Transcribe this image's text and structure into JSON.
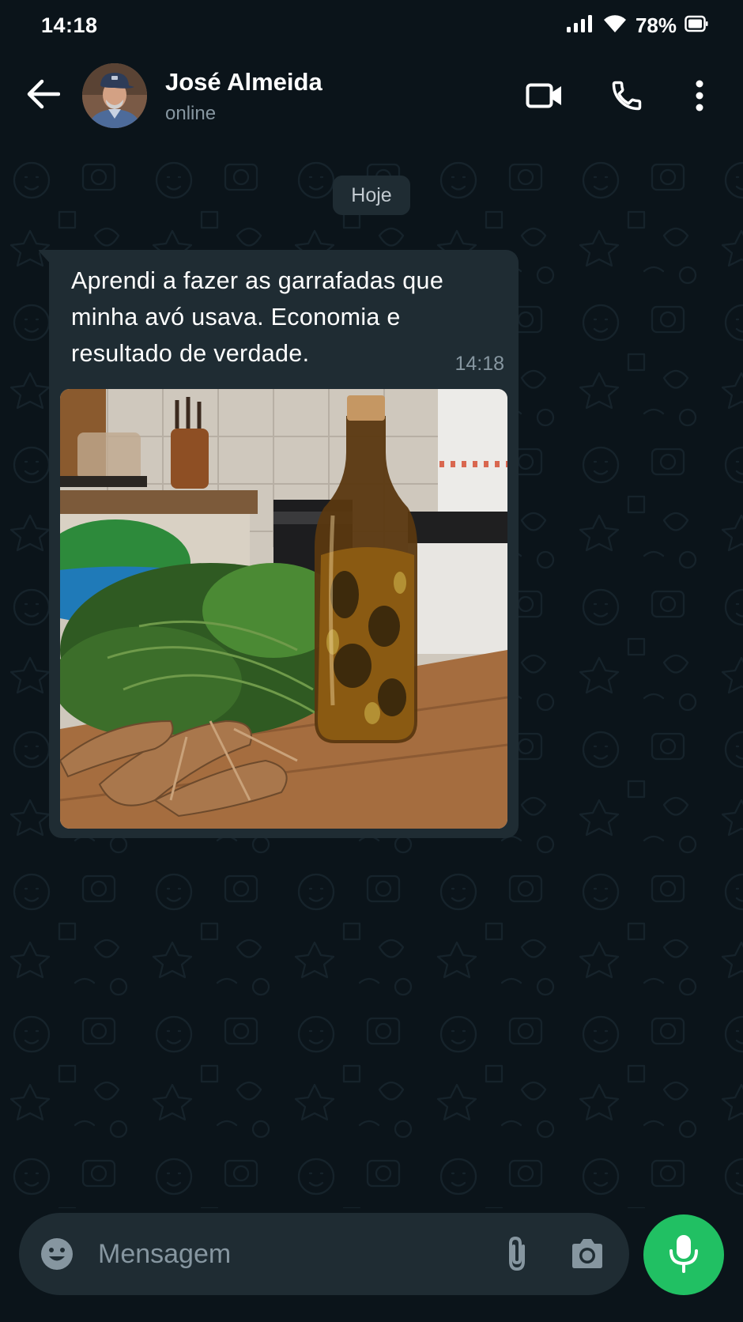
{
  "status_bar": {
    "time": "14:18",
    "battery": "78%",
    "icons": [
      "signal-icon",
      "wifi-icon",
      "battery-icon"
    ]
  },
  "header": {
    "contact_name": "José Almeida",
    "contact_status": "online",
    "icons": [
      "back-arrow-icon",
      "video-call-icon",
      "phone-icon",
      "more-vert-icon"
    ]
  },
  "chat": {
    "date_chip": "Hoje",
    "messages": [
      {
        "text": "Aprendi a fazer as garrafadas que minha avó usava. Economia e resultado de verdade.",
        "time": "14:18",
        "has_photo": true
      }
    ]
  },
  "composer": {
    "placeholder": "Mensagem",
    "icons": [
      "emoji-icon",
      "attach-icon",
      "camera-icon",
      "mic-icon"
    ]
  },
  "colors": {
    "background": "#0b141a",
    "bubble": "#1f2c33",
    "accent": "#21c063",
    "secondary_text": "#8696a0"
  }
}
